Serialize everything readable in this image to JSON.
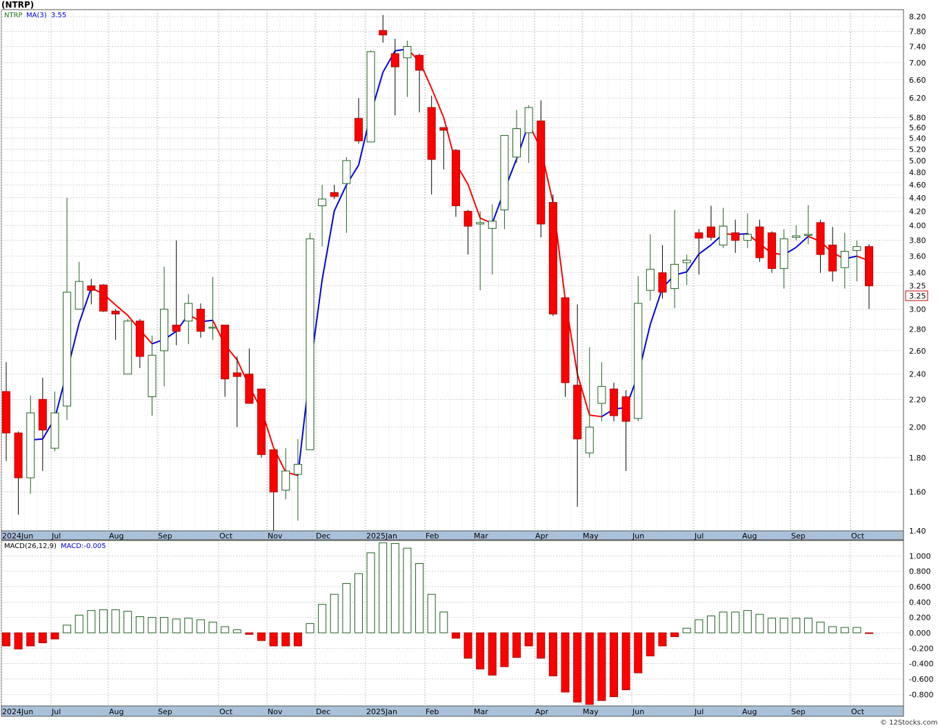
{
  "title": "(NTRP)",
  "legend": {
    "symbol": "NTRP",
    "ma_label": "MA(3)",
    "ma_value": "3.55",
    "macd_label": "MACD(26,12,9)",
    "macd_value_label": "MACD:-0.005"
  },
  "last_price_tag": "3.25",
  "credit": "© 12Stocks.com",
  "colors": {
    "up_candle": "#1f5f1f",
    "down_candle": "#ff0000",
    "ma_up": "#0000dd",
    "ma_down": "#ff0000",
    "grid": "#b4b4b4",
    "axis_band": "#a9c1d9"
  },
  "chart_data": [
    {
      "type": "candlestick",
      "timeframe": "weekly",
      "y_scale": "log",
      "ylim": [
        1.4,
        8.4
      ],
      "y_ticks": [
        "8.20",
        "7.80",
        "7.40",
        "7.00",
        "6.60",
        "6.20",
        "5.80",
        "5.60",
        "5.40",
        "5.20",
        "5.00",
        "4.80",
        "4.60",
        "4.40",
        "4.20",
        "4.00",
        "3.80",
        "3.60",
        "3.40",
        "3.25",
        "3.00",
        "2.80",
        "2.60",
        "2.40",
        "2.20",
        "2.00",
        "1.80",
        "1.60",
        "1.40"
      ],
      "x_labels": [
        "2024Jun",
        "Jul",
        "Aug",
        "Sep",
        "Oct",
        "Nov",
        "Dec",
        "2025Jan",
        "Feb",
        "Mar",
        "Apr",
        "May",
        "Jun",
        "Jul",
        "Aug",
        "Sep",
        "Oct"
      ],
      "candles": [
        [
          2.26,
          2.5,
          1.78,
          1.96
        ],
        [
          1.96,
          1.97,
          1.48,
          1.68
        ],
        [
          1.68,
          2.23,
          1.59,
          2.1
        ],
        [
          2.2,
          2.37,
          1.72,
          1.98
        ],
        [
          1.86,
          2.26,
          1.84,
          2.1
        ],
        [
          2.15,
          4.4,
          2.05,
          3.18
        ],
        [
          3.0,
          3.53,
          3.0,
          3.3
        ],
        [
          3.25,
          3.33,
          3.05,
          3.2
        ],
        [
          3.26,
          3.27,
          2.97,
          2.98
        ],
        [
          2.98,
          3.0,
          2.7,
          2.95
        ],
        [
          2.4,
          2.9,
          2.4,
          2.88
        ],
        [
          2.88,
          2.9,
          2.45,
          2.55
        ],
        [
          2.22,
          2.74,
          2.08,
          2.56
        ],
        [
          2.6,
          3.47,
          2.3,
          3.0
        ],
        [
          2.84,
          3.8,
          2.65,
          2.78
        ],
        [
          2.88,
          3.16,
          2.66,
          3.06
        ],
        [
          3.0,
          3.06,
          2.72,
          2.78
        ],
        [
          2.82,
          3.35,
          2.7,
          2.82
        ],
        [
          2.84,
          2.84,
          2.22,
          2.36
        ],
        [
          2.41,
          2.55,
          2.0,
          2.38
        ],
        [
          2.4,
          2.62,
          2.19,
          2.17
        ],
        [
          2.28,
          2.28,
          1.8,
          1.82
        ],
        [
          1.85,
          1.85,
          1.39,
          1.6
        ],
        [
          1.61,
          1.86,
          1.56,
          1.72
        ],
        [
          1.7,
          1.92,
          1.45,
          1.76
        ],
        [
          1.85,
          3.9,
          1.85,
          3.82
        ],
        [
          4.28,
          4.6,
          3.72,
          4.38
        ],
        [
          4.48,
          4.6,
          4.38,
          4.42
        ],
        [
          4.62,
          5.06,
          3.9,
          5.0
        ],
        [
          5.78,
          6.2,
          5.3,
          5.35
        ],
        [
          5.33,
          7.3,
          5.33,
          7.27
        ],
        [
          7.82,
          8.25,
          7.5,
          7.7
        ],
        [
          7.22,
          7.6,
          5.84,
          6.9
        ],
        [
          7.12,
          7.55,
          6.22,
          7.4
        ],
        [
          7.18,
          7.22,
          5.9,
          6.82
        ],
        [
          6.0,
          6.25,
          4.45,
          5.02
        ],
        [
          5.6,
          5.6,
          4.85,
          5.55
        ],
        [
          5.18,
          5.2,
          4.12,
          4.28
        ],
        [
          4.2,
          4.22,
          3.62,
          3.99
        ],
        [
          4.02,
          4.2,
          3.2,
          4.04
        ],
        [
          3.96,
          4.3,
          3.38,
          4.06
        ],
        [
          4.22,
          5.4,
          3.95,
          5.45
        ],
        [
          5.06,
          5.95,
          4.96,
          5.58
        ],
        [
          5.5,
          6.05,
          4.96,
          6.0
        ],
        [
          5.73,
          6.15,
          3.84,
          4.02
        ],
        [
          4.33,
          4.45,
          2.93,
          2.95
        ],
        [
          3.12,
          3.12,
          2.22,
          2.33
        ],
        [
          2.31,
          3.05,
          1.52,
          1.92
        ],
        [
          1.83,
          2.63,
          1.8,
          2.0
        ],
        [
          2.17,
          2.5,
          2.04,
          2.3
        ],
        [
          2.28,
          2.33,
          2.04,
          2.08
        ],
        [
          2.22,
          2.27,
          1.72,
          2.04
        ],
        [
          2.06,
          3.36,
          2.04,
          3.06
        ],
        [
          3.2,
          3.88,
          3.09,
          3.44
        ],
        [
          3.4,
          3.74,
          3.11,
          3.18
        ],
        [
          3.22,
          4.22,
          3.01,
          3.5
        ],
        [
          3.52,
          3.62,
          3.26,
          3.55
        ],
        [
          3.9,
          3.95,
          3.38,
          3.83
        ],
        [
          3.98,
          4.28,
          3.8,
          3.84
        ],
        [
          3.74,
          4.25,
          3.7,
          3.99
        ],
        [
          3.9,
          4.08,
          3.64,
          3.8
        ],
        [
          3.8,
          4.17,
          3.7,
          3.88
        ],
        [
          3.98,
          4.08,
          3.53,
          3.58
        ],
        [
          3.9,
          3.92,
          3.4,
          3.45
        ],
        [
          3.45,
          3.95,
          3.22,
          3.82
        ],
        [
          3.84,
          4.0,
          3.8,
          3.86
        ],
        [
          3.87,
          4.29,
          3.75,
          3.88
        ],
        [
          4.04,
          4.08,
          3.4,
          3.62
        ],
        [
          3.74,
          3.98,
          3.3,
          3.42
        ],
        [
          3.46,
          3.9,
          3.22,
          3.66
        ],
        [
          3.67,
          3.8,
          3.3,
          3.72
        ],
        [
          3.72,
          3.75,
          3.0,
          3.25
        ]
      ]
    },
    {
      "type": "bar",
      "name": "MACD(26,12,9)",
      "ylim": [
        -0.95,
        1.2
      ],
      "y_ticks": [
        "1.000",
        "0.800",
        "0.600",
        "0.400",
        "0.200",
        "0.000",
        "-0.200",
        "-0.400",
        "-0.600",
        "-0.800"
      ],
      "values": [
        -0.17,
        -0.21,
        -0.17,
        -0.13,
        -0.08,
        0.1,
        0.23,
        0.29,
        0.3,
        0.3,
        0.28,
        0.21,
        0.2,
        0.2,
        0.18,
        0.19,
        0.17,
        0.14,
        0.08,
        0.04,
        -0.02,
        -0.1,
        -0.17,
        -0.17,
        -0.17,
        0.12,
        0.37,
        0.5,
        0.64,
        0.77,
        1.04,
        1.17,
        1.16,
        1.1,
        0.9,
        0.5,
        0.27,
        -0.07,
        -0.33,
        -0.47,
        -0.55,
        -0.44,
        -0.32,
        -0.17,
        -0.33,
        -0.56,
        -0.77,
        -0.9,
        -0.93,
        -0.88,
        -0.83,
        -0.74,
        -0.52,
        -0.3,
        -0.17,
        -0.05,
        0.06,
        0.17,
        0.22,
        0.27,
        0.27,
        0.29,
        0.24,
        0.19,
        0.19,
        0.19,
        0.19,
        0.14,
        0.08,
        0.07,
        0.07,
        -0.005
      ]
    }
  ]
}
